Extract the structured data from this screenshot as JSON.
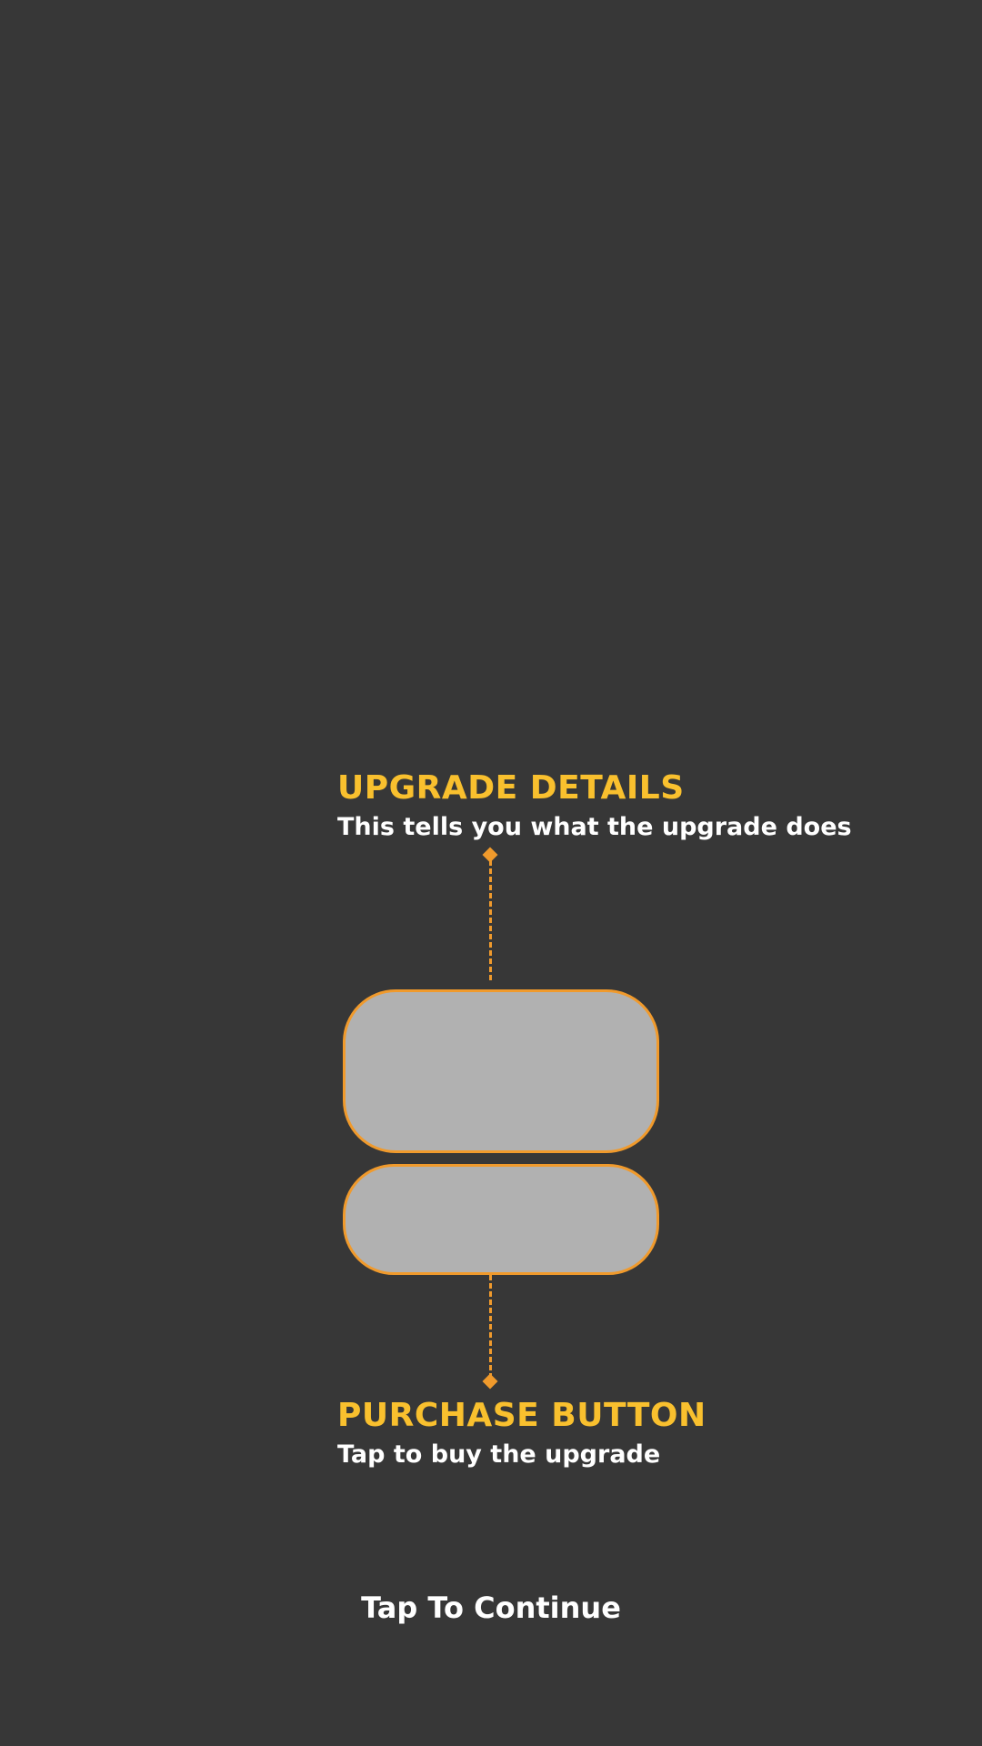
{
  "colors": {
    "background": "#373737",
    "title": "#F9C02E",
    "text": "#FFFFFF",
    "accent": "#F09A2C",
    "placeholder_fill": "#B1B1B1"
  },
  "callouts": {
    "upgrade_details": {
      "title": "UPGRADE DETAILS",
      "description": "This tells you what the upgrade does"
    },
    "purchase_button": {
      "title": "PURCHASE BUTTON",
      "description": "Tap to buy the upgrade"
    }
  },
  "prompt": {
    "continue_label": "Tap To Continue"
  }
}
